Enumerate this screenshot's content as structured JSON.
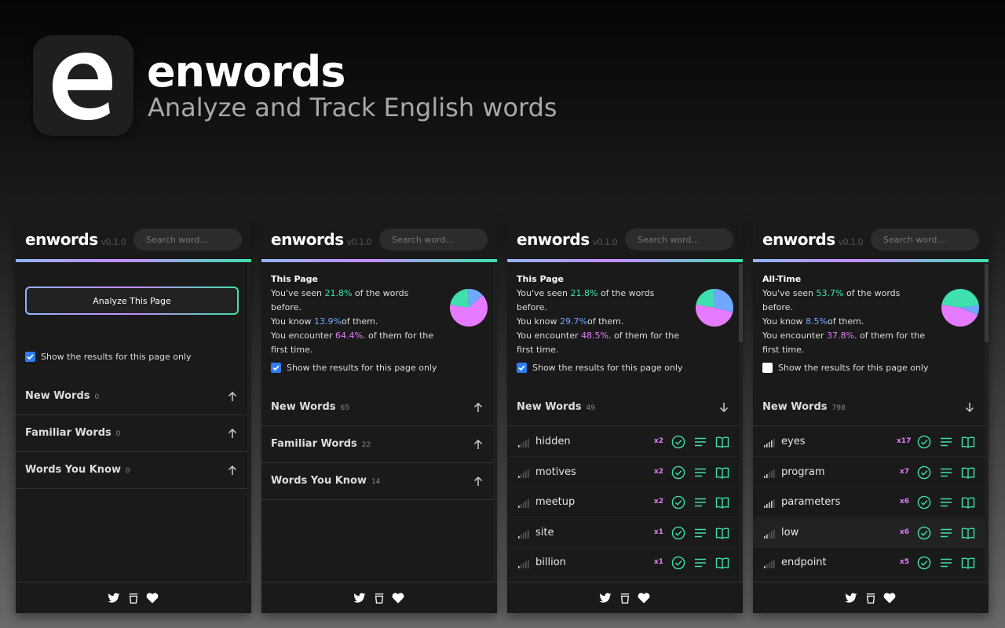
{
  "hero": {
    "logo_letter": "e",
    "title": "enwords",
    "subtitle": "Analyze and Track English words"
  },
  "panels": [
    {
      "brand": "enwords",
      "version": "v0.1.0",
      "search_placeholder": "Search word...",
      "analyze_label": "Analyze This Page",
      "checkbox_label": "Show the results for this page only",
      "checkbox_checked": true,
      "sections": [
        {
          "title": "New Words",
          "count": "0",
          "arrow": "up"
        },
        {
          "title": "Familiar Words",
          "count": "0",
          "arrow": "up"
        },
        {
          "title": "Words You Know",
          "count": "0",
          "arrow": "up"
        }
      ]
    },
    {
      "brand": "enwords",
      "version": "v0.1.0",
      "search_placeholder": "Search word...",
      "stats": {
        "label": "This Page",
        "l1a": "You've seen ",
        "seen": "21.8%",
        "l1b": " of the words before.",
        "l2a": "You know ",
        "know": "13.9%",
        "l2b": "of them.",
        "l3a": "You encounter ",
        "first": "64.4%",
        "l3b": ". of them for the first time."
      },
      "pie": {
        "green": 0.219,
        "blue": 0.141,
        "pink": 0.64
      },
      "checkbox_label": "Show the results for this page only",
      "checkbox_checked": true,
      "sections": [
        {
          "title": "New Words",
          "count": "65",
          "arrow": "up"
        },
        {
          "title": "Familiar Words",
          "count": "22",
          "arrow": "up"
        },
        {
          "title": "Words You Know",
          "count": "14",
          "arrow": "up"
        }
      ]
    },
    {
      "brand": "enwords",
      "version": "v0.1.0",
      "search_placeholder": "Search word...",
      "stats": {
        "label": "This Page",
        "l1a": "You've seen ",
        "seen": "21.8%",
        "l1b": " of the words before.",
        "l2a": "You know ",
        "know": "29.7%",
        "l2b": "of them.",
        "l3a": "You encounter ",
        "first": "48.5%",
        "l3b": ". of them for the first time."
      },
      "pie": {
        "green": 0.218,
        "blue": 0.297,
        "pink": 0.485
      },
      "checkbox_label": "Show the results for this page only",
      "checkbox_checked": true,
      "section": {
        "title": "New Words",
        "count": "49",
        "arrow": "down"
      },
      "words": [
        {
          "word": "hidden",
          "freq": "x2",
          "level": 1
        },
        {
          "word": "motives",
          "freq": "x2",
          "level": 1
        },
        {
          "word": "meetup",
          "freq": "x2",
          "level": 1
        },
        {
          "word": "site",
          "freq": "x1",
          "level": 1
        },
        {
          "word": "billion",
          "freq": "x1",
          "level": 1
        }
      ]
    },
    {
      "brand": "enwords",
      "version": "v0.1.0",
      "search_placeholder": "Search word...",
      "stats": {
        "label": "All-Time",
        "l1a": "You've seen ",
        "seen": "53.7%",
        "l1b": " of the words before.",
        "l2a": "You know ",
        "know": "8.5%",
        "l2b": "of them.",
        "l3a": "You encounter ",
        "first": "37.8%",
        "l3b": ". of them for the first time."
      },
      "pie": {
        "green": 0.452,
        "blue": 0.085,
        "pink": 0.463
      },
      "checkbox_label": "Show the results for this page only",
      "checkbox_checked": false,
      "section": {
        "title": "New Words",
        "count": "798",
        "arrow": "down"
      },
      "words": [
        {
          "word": "eyes",
          "freq": "x17",
          "level": 4
        },
        {
          "word": "program",
          "freq": "x7",
          "level": 2
        },
        {
          "word": "parameters",
          "freq": "x6",
          "level": 4
        },
        {
          "word": "low",
          "freq": "x6",
          "level": 2
        },
        {
          "word": "endpoint",
          "freq": "x5",
          "level": 1
        }
      ]
    }
  ],
  "footer_icons": [
    "twitter-icon",
    "cup-icon",
    "heart-icon"
  ],
  "colors": {
    "green": "#3ee0b0",
    "blue": "#6ea8ff",
    "pink": "#e77bff",
    "panel": "#1a1a1a"
  }
}
